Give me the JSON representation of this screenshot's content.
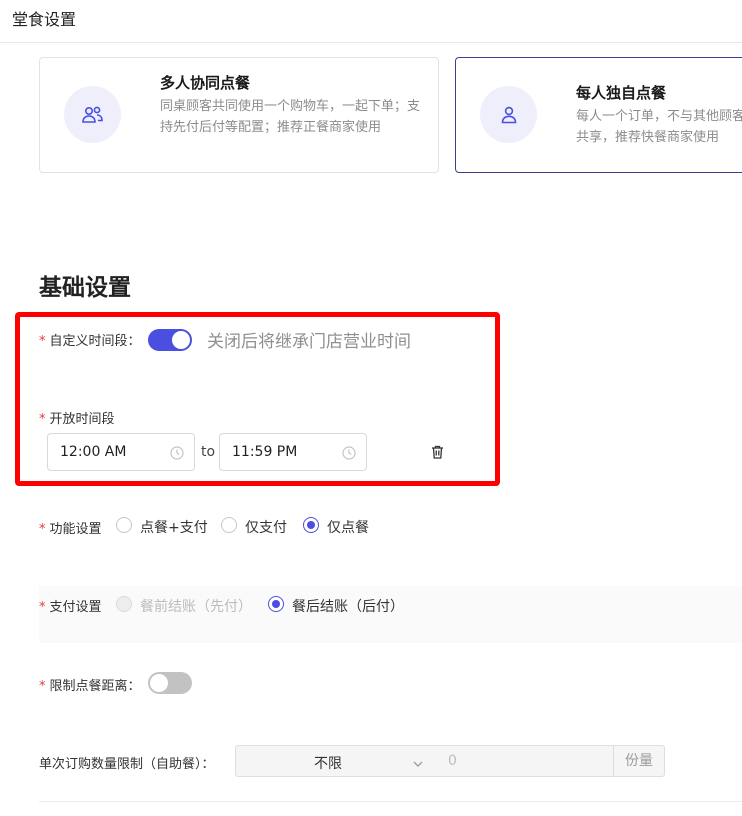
{
  "page": {
    "title": "堂食设置"
  },
  "modes": {
    "multi": {
      "title": "多人协同点餐",
      "desc": "同桌顾客共同使用一个购物车，一起下单；支持先付后付等配置；推荐正餐商家使用",
      "icon": "users-icon"
    },
    "single": {
      "title": "每人独自点餐",
      "desc": "每人一个订单，不与其他顾客共享，推荐快餐商家使用",
      "icon": "user-icon",
      "selected": true
    }
  },
  "basic": {
    "section_title": "基础设置",
    "required_mark": "*",
    "custom_time": {
      "label": "自定义时间段：",
      "enabled": true,
      "hint": "关闭后将继承门店营业时间"
    },
    "open_time": {
      "label": "开放时间段",
      "start": "12:00 AM",
      "to": "to",
      "end": "11:59 PM"
    },
    "function": {
      "label": "功能设置",
      "options": [
        "点餐+支付",
        "仅支付",
        "仅点餐"
      ],
      "selected": "仅点餐"
    },
    "payment": {
      "label": "支付设置",
      "options": [
        "餐前结账（先付）",
        "餐后结账（后付）"
      ],
      "selected": "餐后结账（后付）",
      "disabled": "餐前结账（先付）"
    },
    "distance": {
      "label": "限制点餐距离：",
      "enabled": false
    },
    "quantity": {
      "label": "单次订购数量限制（自助餐）：",
      "select_value": "不限",
      "input_value": "0",
      "unit": "份量"
    }
  },
  "colors": {
    "accent": "#4a4fe0",
    "highlight": "#ff0000",
    "required": "#e23a3a"
  }
}
